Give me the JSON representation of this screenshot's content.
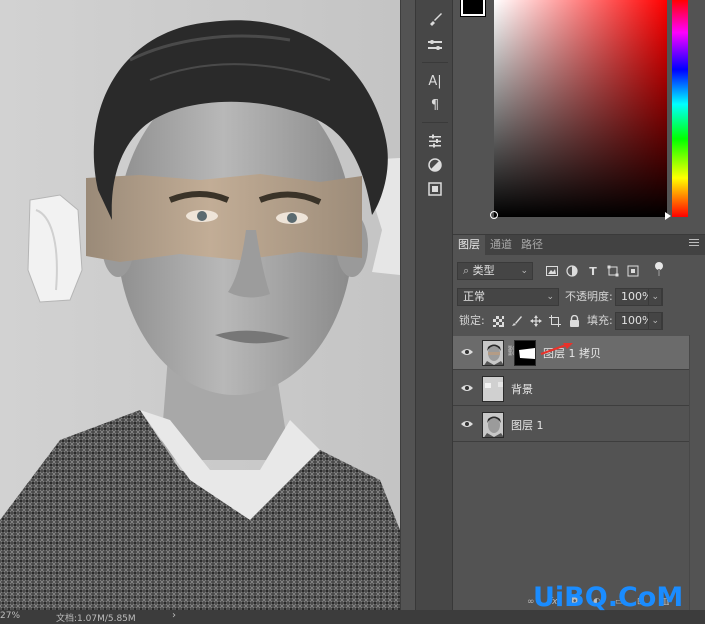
{
  "status": {
    "zoom": "27%",
    "doc_info": "文档:1.07M/5.85M",
    "arrow": "›"
  },
  "tools": [
    {
      "name": "brush-settings-icon"
    },
    {
      "name": "brush-presets-icon"
    },
    {
      "name": "character-icon",
      "glyph": "A|"
    },
    {
      "name": "paragraph-icon",
      "glyph": "¶"
    },
    {
      "name": "adjustments-icon"
    },
    {
      "name": "styles-icon"
    },
    {
      "name": "properties-icon"
    }
  ],
  "color": {
    "foreground": "#000000",
    "picker_hue": "#ff0000"
  },
  "layers_panel": {
    "tabs": [
      "图层",
      "通道",
      "路径"
    ],
    "filter": {
      "label": "类型",
      "icons": [
        "image-filter-icon",
        "adjustment-filter-icon",
        "type-filter-icon",
        "shape-filter-icon",
        "smart-object-filter-icon",
        "filter-toggle-icon"
      ]
    },
    "blend_mode": "正常",
    "opacity_label": "不透明度:",
    "opacity_value": "100%",
    "lock_label": "锁定:",
    "fill_label": "填充:",
    "fill_value": "100%",
    "layers": [
      {
        "name": "图层 1 拷贝",
        "selected": true,
        "has_mask": true
      },
      {
        "name": "背景",
        "selected": false,
        "has_mask": false
      },
      {
        "name": "图层 1",
        "selected": false,
        "has_mask": false
      }
    ],
    "bottom_icons": [
      "link-icon",
      "fx-icon",
      "mask-icon",
      "adjustment-layer-icon",
      "group-icon",
      "new-layer-icon",
      "trash-icon"
    ],
    "fx_label": "fx"
  },
  "watermark": "UiBQ.CoM",
  "accent": "#e8322a"
}
